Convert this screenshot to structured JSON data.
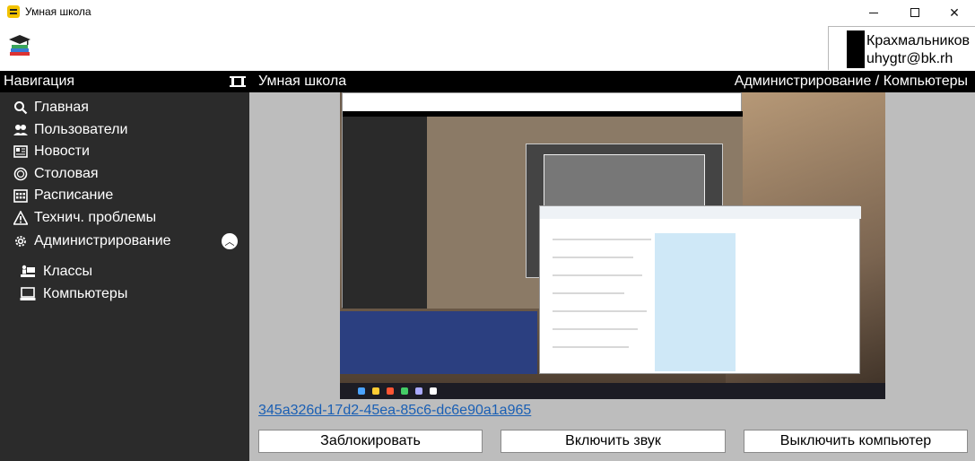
{
  "window": {
    "title": "Умная школа"
  },
  "header": {
    "user_name": "Крахмальников",
    "user_email": "uhygtr@bk.rh"
  },
  "sidebar": {
    "title": "Навигация",
    "items": [
      {
        "label": "Главная",
        "icon": "search-icon"
      },
      {
        "label": "Пользователи",
        "icon": "users-icon"
      },
      {
        "label": "Новости",
        "icon": "newspaper-icon"
      },
      {
        "label": "Столовая",
        "icon": "dining-icon"
      },
      {
        "label": "Расписание",
        "icon": "calendar-icon"
      },
      {
        "label": "Технич. проблемы",
        "icon": "warning-icon"
      },
      {
        "label": "Администрирование",
        "icon": "gear-icon"
      }
    ],
    "subitems": [
      {
        "label": "Классы",
        "icon": "classroom-icon"
      },
      {
        "label": "Компьютеры",
        "icon": "computer-icon"
      }
    ]
  },
  "main": {
    "title": "Умная школа",
    "breadcrumb": "Администрирование / Компьютеры",
    "device_id": "345a326d-17d2-45ea-85c6-dc6e90a1a965",
    "buttons": {
      "lock": "Заблокировать",
      "sound": "Включить звук",
      "shutdown": "Выключить компьютер"
    }
  },
  "colors": {
    "sidebar_bg": "#2b2b2b",
    "header_bar": "#000000",
    "main_bg": "#bdbdbd",
    "link": "#1a5fb4",
    "app_icon": "#f2c200"
  }
}
